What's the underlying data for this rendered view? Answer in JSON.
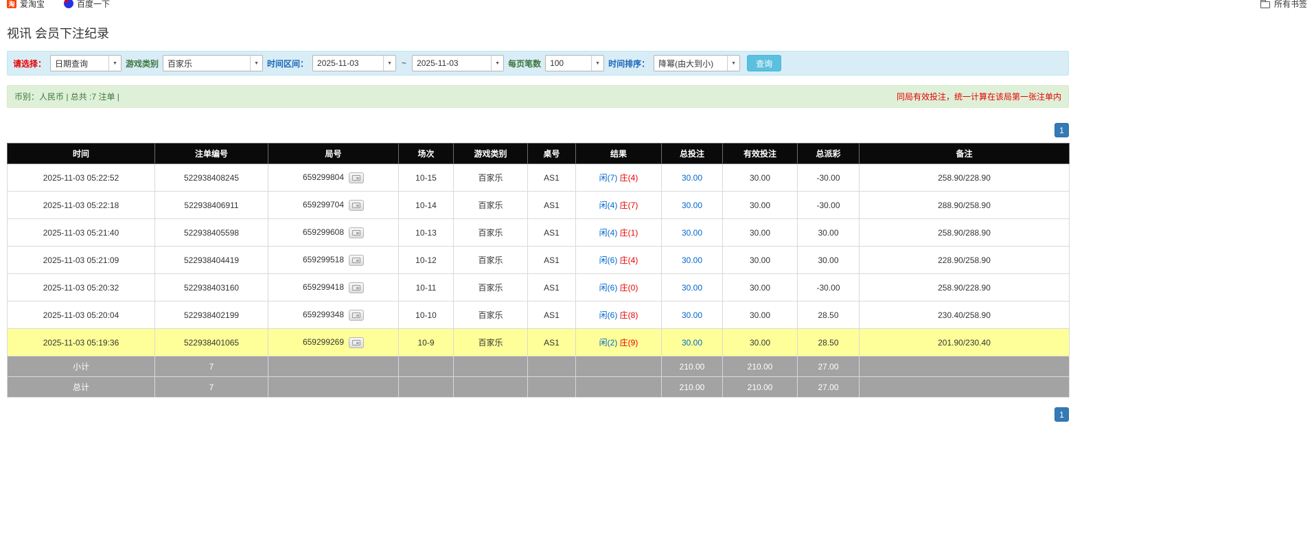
{
  "colors": {
    "player_blue": "#0066cc",
    "banker_red": "#e60000",
    "negative_red": "#e60000",
    "link_blue": "#0066cc",
    "highlight_yellow": "#ffff99",
    "pagination_blue": "#337ab7",
    "search_button_blue": "#5bc0de",
    "header_black": "#0a0a0a",
    "footer_gray": "#a3a3a3",
    "filter_bar_bg": "#d9edf7",
    "summary_green_bg": "#dff0d8",
    "summary_text_green": "#3c763d",
    "alert_red": "#e60000",
    "label_blue": "#1a66b8",
    "label_green": "#3c763d"
  },
  "bookmarks_bar": {
    "items": [
      {
        "label": "爱淘宝",
        "icon": "taobao-icon"
      },
      {
        "label": "百度一下",
        "icon": "baidu-icon"
      }
    ],
    "all_bookmarks": {
      "label": "所有书签",
      "icon": "folder-icon"
    }
  },
  "page": {
    "title": "视讯 会员下注纪录"
  },
  "filters": {
    "select_label": "请选择：",
    "select_value": "日期查询",
    "game_type_label": "游戏类别",
    "game_type_value": "百家乐",
    "time_range_label": "时间区间：",
    "date_from": "2025-11-03",
    "date_separator": "~",
    "date_to": "2025-11-03",
    "page_size_label": "每页笔数",
    "page_size_value": "100",
    "sort_label": "时间排序：",
    "sort_value": "降幂(由大到小)",
    "search_button": "查询"
  },
  "summary_bar": {
    "left": "币别：人民币 | 总共 :7 注单 |",
    "right": "同局有效投注，统一计算在该局第一张注单内"
  },
  "pagination": {
    "page": "1"
  },
  "table": {
    "headers": [
      "时间",
      "注单编号",
      "局号",
      "场次",
      "游戏类别",
      "桌号",
      "结果",
      "总投注",
      "有效投注",
      "总派彩",
      "备注"
    ],
    "rows": [
      {
        "time": "2025-11-03 05:22:52",
        "bet_id": "522938408245",
        "round_id": "659299804",
        "session": "10-15",
        "game": "百家乐",
        "table_no": "AS1",
        "result_player": "闲(7)",
        "result_banker": "庄(4)",
        "total_bet": "30.00",
        "valid_bet": "30.00",
        "payout": "-30.00",
        "payout_negative": true,
        "remark": "258.90/228.90",
        "highlight": false
      },
      {
        "time": "2025-11-03 05:22:18",
        "bet_id": "522938406911",
        "round_id": "659299704",
        "session": "10-14",
        "game": "百家乐",
        "table_no": "AS1",
        "result_player": "闲(4)",
        "result_banker": "庄(7)",
        "total_bet": "30.00",
        "valid_bet": "30.00",
        "payout": "-30.00",
        "payout_negative": true,
        "remark": "288.90/258.90",
        "highlight": false
      },
      {
        "time": "2025-11-03 05:21:40",
        "bet_id": "522938405598",
        "round_id": "659299608",
        "session": "10-13",
        "game": "百家乐",
        "table_no": "AS1",
        "result_player": "闲(4)",
        "result_banker": "庄(1)",
        "total_bet": "30.00",
        "valid_bet": "30.00",
        "payout": "30.00",
        "payout_negative": false,
        "remark": "258.90/288.90",
        "highlight": false
      },
      {
        "time": "2025-11-03 05:21:09",
        "bet_id": "522938404419",
        "round_id": "659299518",
        "session": "10-12",
        "game": "百家乐",
        "table_no": "AS1",
        "result_player": "闲(6)",
        "result_banker": "庄(4)",
        "total_bet": "30.00",
        "valid_bet": "30.00",
        "payout": "30.00",
        "payout_negative": false,
        "remark": "228.90/258.90",
        "highlight": false
      },
      {
        "time": "2025-11-03 05:20:32",
        "bet_id": "522938403160",
        "round_id": "659299418",
        "session": "10-11",
        "game": "百家乐",
        "table_no": "AS1",
        "result_player": "闲(6)",
        "result_banker": "庄(0)",
        "total_bet": "30.00",
        "valid_bet": "30.00",
        "payout": "-30.00",
        "payout_negative": true,
        "remark": "258.90/228.90",
        "highlight": false
      },
      {
        "time": "2025-11-03 05:20:04",
        "bet_id": "522938402199",
        "round_id": "659299348",
        "session": "10-10",
        "game": "百家乐",
        "table_no": "AS1",
        "result_player": "闲(6)",
        "result_banker": "庄(8)",
        "total_bet": "30.00",
        "valid_bet": "30.00",
        "payout": "28.50",
        "payout_negative": false,
        "remark": "230.40/258.90",
        "highlight": false
      },
      {
        "time": "2025-11-03 05:19:36",
        "bet_id": "522938401065",
        "round_id": "659299269",
        "session": "10-9",
        "game": "百家乐",
        "table_no": "AS1",
        "result_player": "闲(2)",
        "result_banker": "庄(9)",
        "total_bet": "30.00",
        "valid_bet": "30.00",
        "payout": "28.50",
        "payout_negative": false,
        "remark": "201.90/230.40",
        "highlight": true
      }
    ],
    "subtotal": {
      "label": "小计",
      "count": "7",
      "total_bet": "210.00",
      "valid_bet": "210.00",
      "payout": "27.00"
    },
    "total": {
      "label": "总计",
      "count": "7",
      "total_bet": "210.00",
      "valid_bet": "210.00",
      "payout": "27.00"
    }
  }
}
